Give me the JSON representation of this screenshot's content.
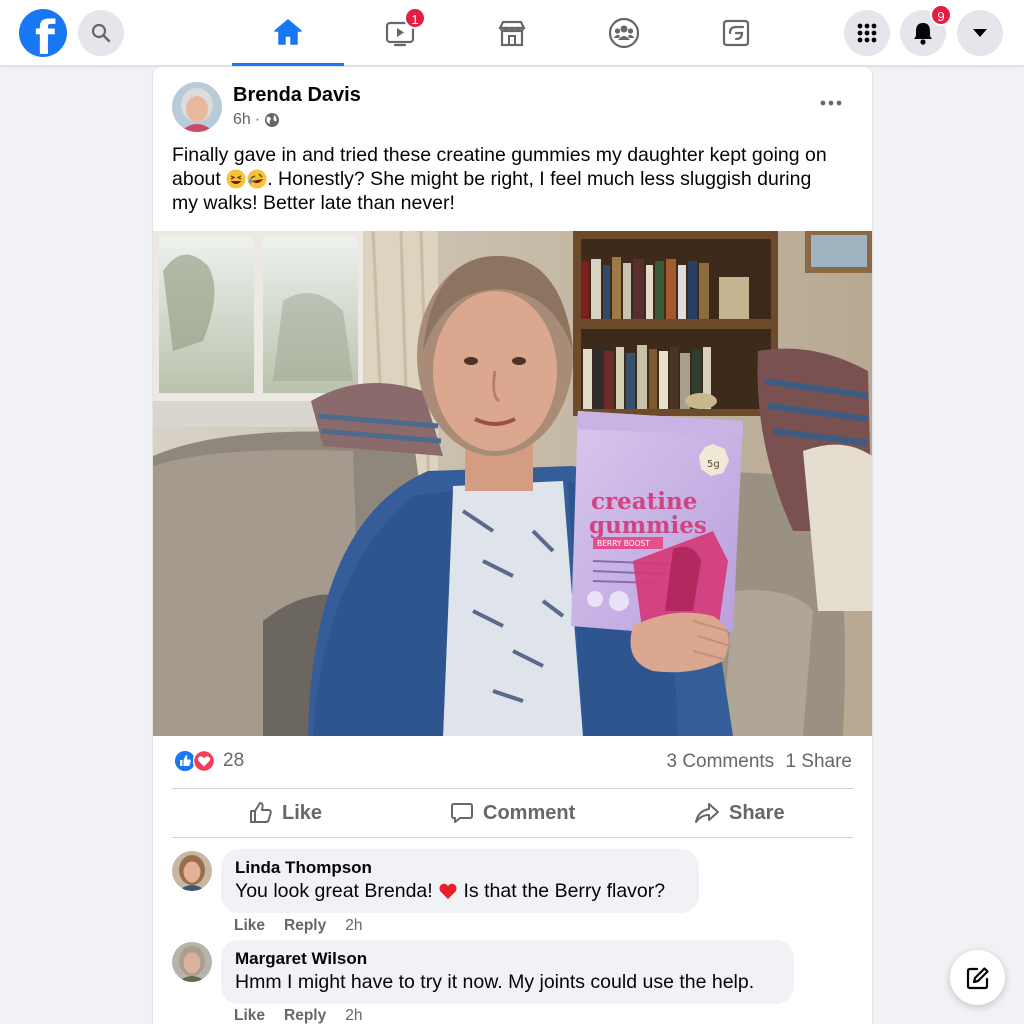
{
  "app": {
    "logo_letter": "f"
  },
  "nav": {
    "tabs": [
      {
        "name": "home",
        "icon": "home-icon",
        "active": true
      },
      {
        "name": "watch",
        "icon": "video-icon",
        "badge": "1"
      },
      {
        "name": "marketplace",
        "icon": "marketplace-icon"
      },
      {
        "name": "groups",
        "icon": "groups-icon"
      },
      {
        "name": "gaming",
        "icon": "gaming-icon"
      }
    ],
    "notifications_badge": "9"
  },
  "post": {
    "author": "Brenda Davis",
    "time": "6h",
    "audience_icon": "globe-icon",
    "text_line1": "Finally gave in and tried these creatine gummies my daughter kept going on",
    "text_line2_pre": "about ",
    "text_line2_post": ". Honestly? She might be right, I feel much less sluggish during",
    "text_line3": "my walks! Better late than never!",
    "emojis": [
      "grinning-squint-emoji",
      "rolling-laughing-emoji"
    ],
    "photo": {
      "package_line1": "creatine",
      "package_line2": "gummies",
      "package_flavor": "BERRY BOOST",
      "package_badge": "5g"
    },
    "reaction_count": "28",
    "reaction_icons": [
      "like-reaction-icon",
      "love-reaction-icon"
    ],
    "comments_count": "3 Comments",
    "shares_count": "1 Share",
    "actions": {
      "like": "Like",
      "comment": "Comment",
      "share": "Share"
    }
  },
  "comments": [
    {
      "author": "Linda Thompson",
      "text_pre": "You look great Brenda! ",
      "text_post": " Is that the Berry flavor?",
      "emoji": "red-heart-emoji",
      "like": "Like",
      "reply": "Reply",
      "time": "2h"
    },
    {
      "author": "Margaret Wilson",
      "text": "Hmm I might have to try it now. My joints could use the help.",
      "like": "Like",
      "reply": "Reply",
      "time": "2h"
    }
  ],
  "colors": {
    "brand": "#1877f2",
    "badge": "#e41e3f",
    "love": "#f33e58"
  }
}
